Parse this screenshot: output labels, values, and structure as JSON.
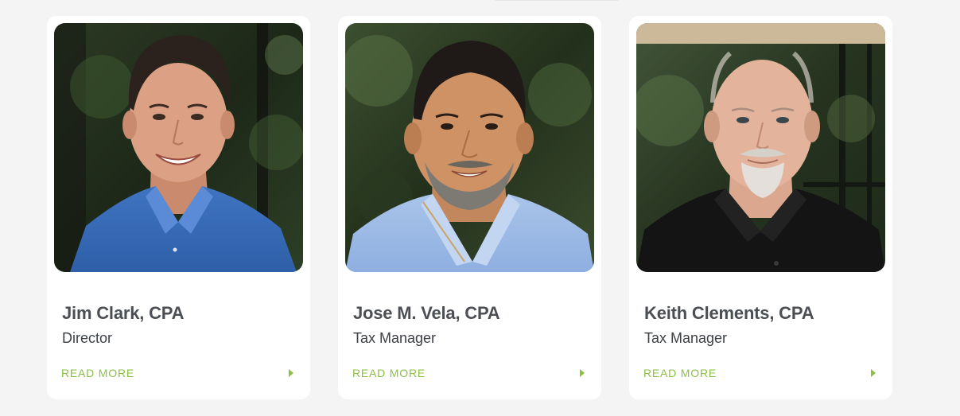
{
  "team": [
    {
      "name": "Jim Clark, CPA",
      "title": "Director",
      "read_more": "READ MORE",
      "photo": "portrait-photo-jim-clark"
    },
    {
      "name": "Jose M. Vela, CPA",
      "title": "Tax Manager",
      "read_more": "READ MORE",
      "photo": "portrait-photo-jose-vela"
    },
    {
      "name": "Keith Clements, CPA",
      "title": "Tax Manager",
      "read_more": "READ MORE",
      "photo": "portrait-photo-keith-clements"
    }
  ],
  "colors": {
    "accent_green": "#8cc044",
    "tab_green": "#5f9a35",
    "name_text": "#4b4f53",
    "page_bg": "#f4f4f4"
  }
}
